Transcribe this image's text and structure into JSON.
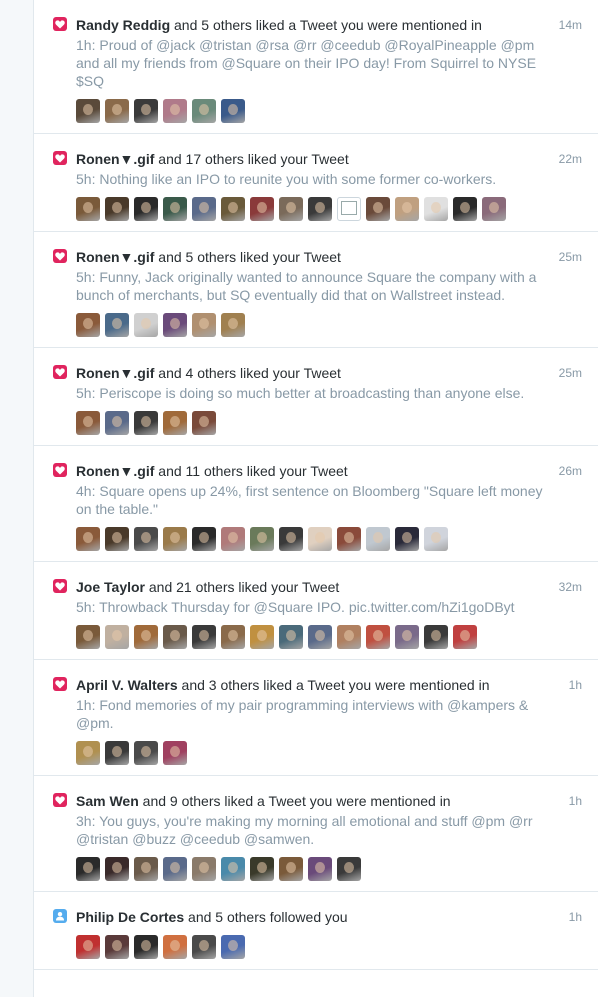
{
  "colors": {
    "heart": "#e0245e",
    "follow": "#55acee",
    "muted": "#8899a6"
  },
  "notifications": [
    {
      "icon": "heart-icon",
      "name": "Randy Reddig",
      "rest": " and 5 others liked a Tweet you were mentioned in",
      "time": "14m",
      "text": "1h: Proud of @jack @tristan @rsa @rr @ceedub @RoyalPineapple @pm and all my friends from @Square on their IPO day! From Squirrel to NYSE $SQ",
      "avatars": [
        "#5a4a3a",
        "#8a6a4a",
        "#3a3a3a",
        "#b07a8a",
        "#6a8a7a",
        "#3a5a8a"
      ]
    },
    {
      "icon": "heart-icon",
      "name": "Ronen▼.gif",
      "rest": " and 17 others liked your Tweet",
      "time": "22m",
      "text": "5h: Nothing like an IPO to reunite you with some former co-workers.",
      "avatars": [
        "#7a5a3a",
        "#4a3a2a",
        "#2a2a2a",
        "#3a5a4a",
        "#5a6a8a",
        "#6a5a3a",
        "#8a3a3a",
        "#7a6a5a",
        "#3a3a3a",
        "broken",
        "#6a4a3a",
        "#c0a080",
        "#e0e0e0",
        "#2a2a2a",
        "#8a6a7a"
      ]
    },
    {
      "icon": "heart-icon",
      "name": "Ronen▼.gif",
      "rest": " and 5 others liked your Tweet",
      "time": "25m",
      "text": "5h: Funny, Jack originally wanted to announce Square the company with a bunch of merchants, but SQ eventually did that on Wallstreet instead.",
      "avatars": [
        "#8a5a3a",
        "#4a6a8a",
        "#d0d0d0",
        "#6a4a7a",
        "#b09070",
        "#a08050"
      ]
    },
    {
      "icon": "heart-icon",
      "name": "Ronen▼.gif",
      "rest": " and 4 others liked your Tweet",
      "time": "25m",
      "text": "5h: Periscope is doing so much better at broadcasting than anyone else.",
      "avatars": [
        "#8a5a3a",
        "#5a6a8a",
        "#3a3a3a",
        "#a06a3a",
        "#7a4a3a"
      ]
    },
    {
      "icon": "heart-icon",
      "name": "Ronen▼.gif",
      "rest": " and 11 others liked your Tweet",
      "time": "26m",
      "text": "4h: Square opens up 24%, first sentence on Bloomberg \"Square left money on the table.\"",
      "avatars": [
        "#8a5a3a",
        "#4a3a2a",
        "#4a4a4a",
        "#9a7a4a",
        "#2a2a2a",
        "#b07a7a",
        "#6a7a5a",
        "#3a3a3a",
        "#e0d0c0",
        "#8a4a3a",
        "#c0c8d0",
        "#2a2a3a",
        "#d0d4dc"
      ]
    },
    {
      "icon": "heart-icon",
      "name": "Joe Taylor",
      "rest": " and 21 others liked your Tweet",
      "time": "32m",
      "text": "5h: Throwback Thursday for @Square IPO. pic.twitter.com/hZi1goDByt",
      "avatars": [
        "#7a5a3a",
        "#c0b0a0",
        "#a06a3a",
        "#6a5a4a",
        "#3a3a3a",
        "#8a6a4a",
        "#c09040",
        "#4a6a7a",
        "#5a6a8a",
        "#b08060",
        "#c05040",
        "#7a6a8a",
        "#3a3a3a",
        "#c04040"
      ]
    },
    {
      "icon": "heart-icon",
      "name": "April V. Walters",
      "rest": " and 3 others liked a Tweet you were mentioned in",
      "time": "1h",
      "text": "1h: Fond memories of my pair programming interviews with @kampers & @pm.",
      "avatars": [
        "#b09050",
        "#3a3a3a",
        "#4a4a4a",
        "#a04060"
      ]
    },
    {
      "icon": "heart-icon",
      "name": "Sam Wen",
      "rest": " and 9 others liked a Tweet you were mentioned in",
      "time": "1h",
      "text": "3h: You guys, you're making my morning all emotional and stuff @pm @rr @tristan @buzz @ceedub @samwen.",
      "avatars": [
        "#2a2a2a",
        "#3a2a2a",
        "#6a5a4a",
        "#5a6a8a",
        "#8a7a6a",
        "#4a8aaa",
        "#3a3a2a",
        "#7a5a3a",
        "#6a4a7a",
        "#3a3a3a"
      ]
    },
    {
      "icon": "person-icon",
      "name": "Philip De Cortes",
      "rest": " and 5 others followed you",
      "time": "1h",
      "text": "",
      "avatars": [
        "#c03030",
        "#5a3a3a",
        "#2a2a2a",
        "#d07040",
        "#4a4a4a",
        "#4a6ab0"
      ]
    }
  ]
}
